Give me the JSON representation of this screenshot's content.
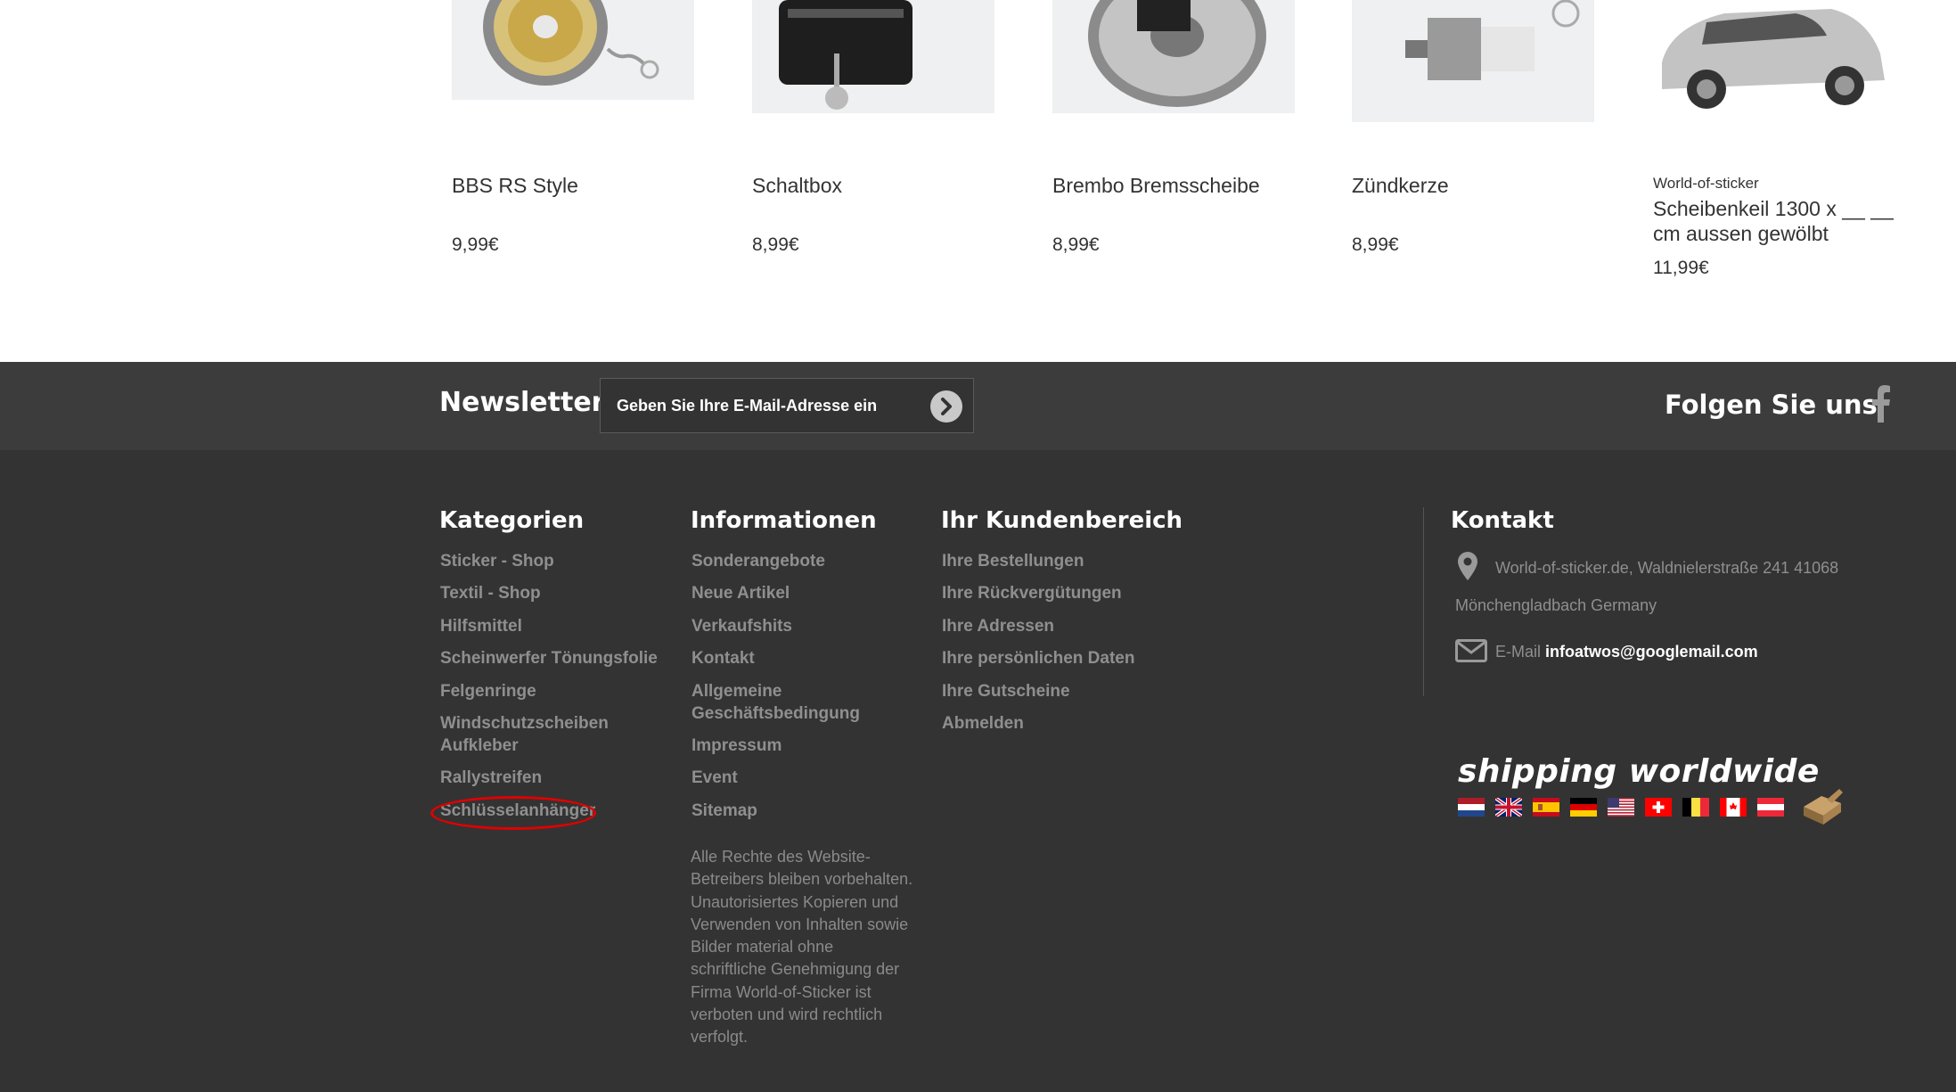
{
  "products": [
    {
      "brand": "",
      "name": "BBS RS Style",
      "price": "9,99€"
    },
    {
      "brand": "",
      "name": "Schaltbox",
      "price": "8,99€"
    },
    {
      "brand": "",
      "name": "Brembo Bremsscheibe",
      "price": "8,99€"
    },
    {
      "brand": "",
      "name": "Zündkerze",
      "price": "8,99€"
    },
    {
      "brand": "World-of-sticker",
      "name": "Scheibenkeil 1300 x __ __ cm aussen gewölbt",
      "price": "11,99€"
    }
  ],
  "newsletter": {
    "title": "Newsletter",
    "placeholder": "Geben Sie Ihre E-Mail-Adresse ein"
  },
  "follow": {
    "title": "Folgen Sie uns",
    "icon": "facebook-icon"
  },
  "footer": {
    "categories": {
      "title": "Kategorien",
      "items": [
        "Sticker - Shop",
        "Textil - Shop",
        "Hilfsmittel",
        "Scheinwerfer Tönungsfolie",
        "Felgenringe",
        "Windschutzscheiben Aufkleber",
        "Rallystreifen",
        "Schlüsselanhänger"
      ]
    },
    "information": {
      "title": "Informationen",
      "items": [
        "Sonderangebote",
        "Neue Artikel",
        "Verkaufshits",
        "Kontakt",
        "Allgemeine Geschäftsbedingung",
        "Impressum",
        "Event",
        "Sitemap"
      ],
      "copyright": "Alle Rechte des Website-Betreibers bleiben vorbehalten. Unautorisiertes Kopieren und Verwenden von Inhalten sowie Bilder material ohne schriftliche Genehmigung der Firma World-of-Sticker ist verboten und wird rechtlich verfolgt."
    },
    "account": {
      "title": "Ihr Kundenbereich",
      "items": [
        "Ihre Bestellungen",
        "Ihre Rückvergütungen",
        "Ihre Adressen",
        "Ihre persönlichen Daten",
        "Ihre Gutscheine",
        "Abmelden"
      ]
    },
    "contact": {
      "title": "Kontakt",
      "address_line1": "World-of-sticker.de, Waldnielerstraße 241 41068",
      "address_line2": "Mönchengladbach Germany",
      "email_label": "E-Mail",
      "email": "infoatwos@googlemail.com"
    },
    "shipping": {
      "title": "shipping worldwide",
      "flags": [
        "netherlands-flag",
        "uk-flag",
        "spain-flag",
        "germany-flag",
        "usa-flag",
        "switzerland-flag",
        "belgium-flag",
        "canada-flag",
        "austria-flag",
        "parcel-box"
      ]
    }
  },
  "colors": {
    "newsletter_bg": "#3c3c3c",
    "footer_bg": "#333333",
    "link": "#8f8f8f",
    "highlight": "#e00000"
  }
}
